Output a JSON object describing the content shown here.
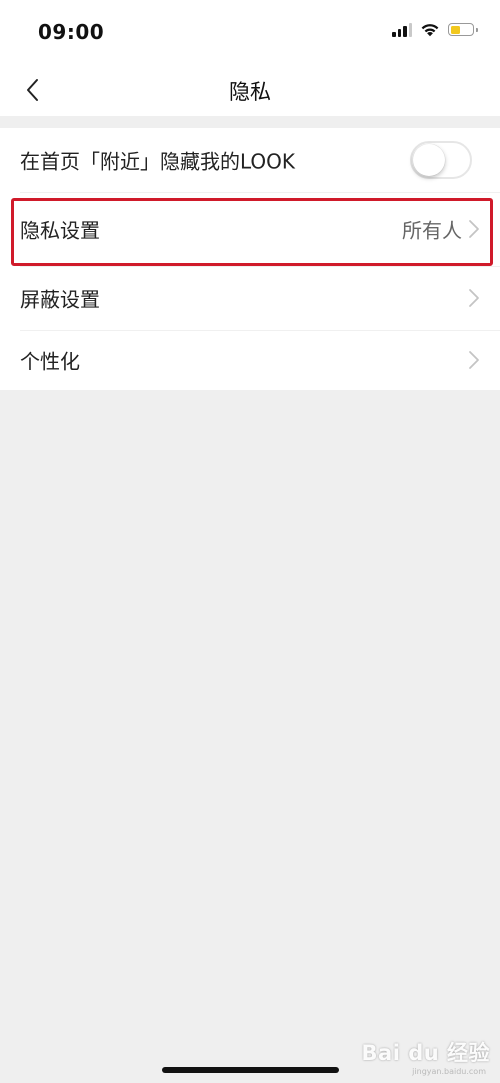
{
  "status_bar": {
    "time": "09:00",
    "battery_level": 0.45,
    "battery_color": "#f2c81e"
  },
  "nav": {
    "title": "隐私",
    "back_icon": "chevron-left-icon"
  },
  "settings": {
    "hide_nearby": {
      "label": "在首页「附近」隐藏我的LOOK",
      "toggle_on": false
    },
    "privacy_settings": {
      "label": "隐私设置",
      "value": "所有人"
    },
    "block_settings": {
      "label": "屏蔽设置"
    },
    "personalization": {
      "label": "个性化"
    }
  },
  "annotation": {
    "highlight_color": "#d01a2a"
  },
  "watermark": {
    "text": "Bai du 经验",
    "sub": "jingyan.baidu.com"
  }
}
